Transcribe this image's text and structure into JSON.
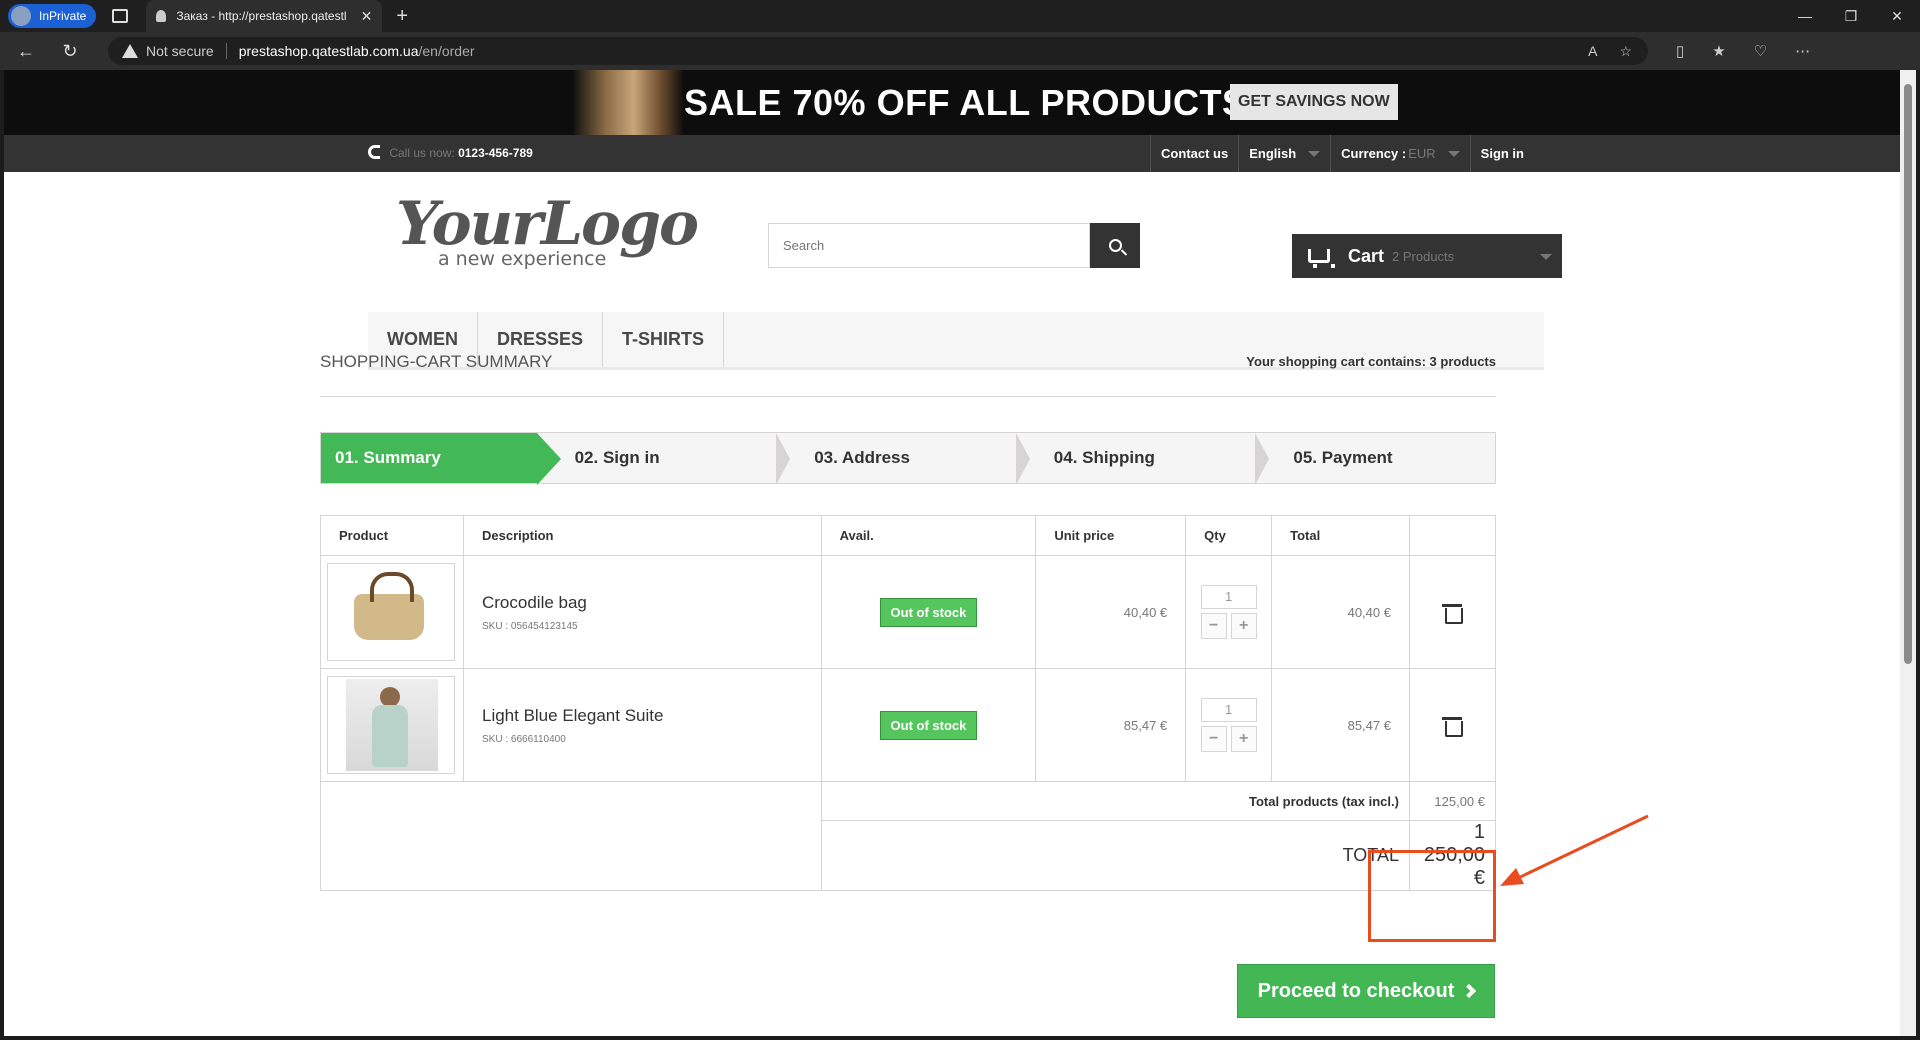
{
  "browser": {
    "inprivate_label": "InPrivate",
    "tab_title": "Заказ - http://prestashop.qatestl",
    "tab_close": "✕",
    "new_tab": "+",
    "security_label": "Not secure",
    "url_host": "prestashop.qatestlab.com.ua",
    "url_path": "/en/order"
  },
  "banner": {
    "headline": "SALE 70% OFF ALL PRODUCTS",
    "cta": "GET SAVINGS NOW"
  },
  "topbar": {
    "call_label": "Call us now:",
    "phone": "0123-456-789",
    "contact": "Contact us",
    "language": "English",
    "currency_label": "Currency :",
    "currency_value": "EUR",
    "signin": "Sign in"
  },
  "header": {
    "logo_main": "YourLogo",
    "logo_tagline": "a new experience",
    "search_placeholder": "Search",
    "cart_label": "Cart",
    "cart_count": "2 Products"
  },
  "menu": [
    "Women",
    "Dresses",
    "T-shirts"
  ],
  "summary": {
    "heading": "Shopping-cart summary",
    "cart_contains_prefix": "Your shopping cart contains:",
    "cart_contains_count": "3 products",
    "steps": [
      "01. Summary",
      "02. Sign in",
      "03. Address",
      "04. Shipping",
      "05. Payment"
    ],
    "columns": [
      "Product",
      "Description",
      "Avail.",
      "Unit price",
      "Qty",
      "Total"
    ],
    "rows": [
      {
        "name": "Crocodile bag",
        "sku": "SKU : 056454123145",
        "avail": "Out of stock",
        "unit_price": "40,40 €",
        "qty": "1",
        "total": "40,40 €"
      },
      {
        "name": "Light Blue Elegant Suite",
        "sku": "SKU : 6666110400",
        "avail": "Out of stock",
        "unit_price": "85,47 €",
        "qty": "1",
        "total": "85,47 €"
      }
    ],
    "total_products_label": "Total products (tax incl.)",
    "total_products_value": "125,00 €",
    "total_label": "TOTAL",
    "total_value": "1 250,00 €",
    "checkout": "Proceed to checkout"
  },
  "colors": {
    "accent_green": "#43b754",
    "highlight_red": "#e84c1f",
    "dark_bar": "#333333"
  }
}
